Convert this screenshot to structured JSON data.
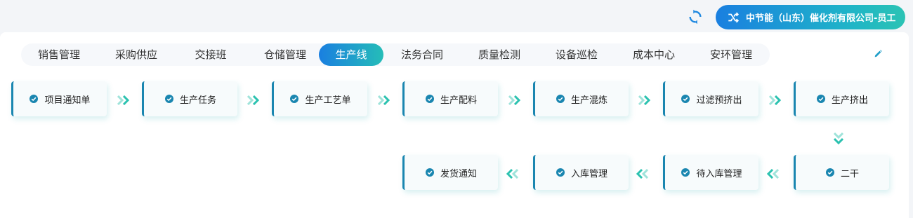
{
  "header": {
    "refresh_icon": "refresh-icon",
    "user": {
      "icon": "shuffle-icon",
      "label": "中节能（山东）催化剂有限公司-员工"
    }
  },
  "tabs": [
    {
      "label": "销售管理",
      "active": false
    },
    {
      "label": "采购供应",
      "active": false
    },
    {
      "label": "交接班",
      "active": false
    },
    {
      "label": "仓储管理",
      "active": false
    },
    {
      "label": "生产线",
      "active": true
    },
    {
      "label": "法务合同",
      "active": false
    },
    {
      "label": "质量检测",
      "active": false
    },
    {
      "label": "设备巡检",
      "active": false
    },
    {
      "label": "成本中心",
      "active": false
    },
    {
      "label": "安环管理",
      "active": false
    }
  ],
  "edit_icon": "pencil-icon",
  "flow": {
    "row1": [
      "项目通知单",
      "生产任务",
      "生产工艺单",
      "生产配料",
      "生产混炼",
      "过滤预挤出",
      "生产挤出"
    ],
    "row2": [
      "发货通知",
      "入库管理",
      "待入库管理",
      "二干"
    ],
    "node_icon": "check-circle-icon",
    "arrow_icon": "double-chevron-icon"
  },
  "colors": {
    "accent_start": "#1a7fe0",
    "accent_end": "#25bdb8",
    "node_border": "#1a86b0",
    "check": "#1a86b0",
    "arrow": "#2cc2b0"
  }
}
